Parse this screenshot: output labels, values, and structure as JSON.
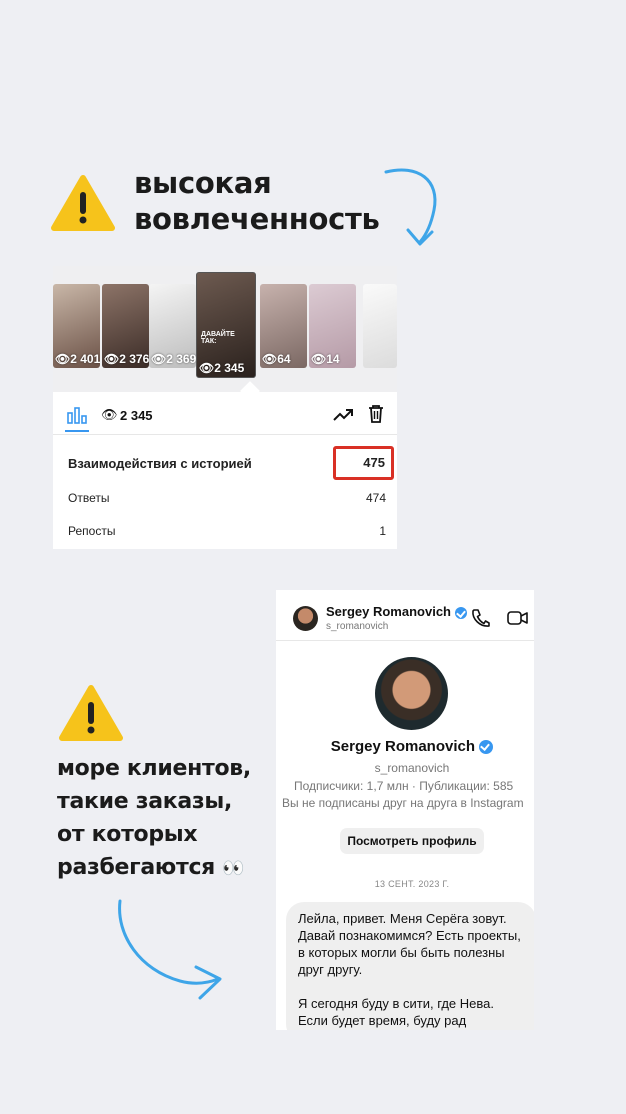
{
  "section1": {
    "warning_icon": "warning-icon",
    "headline_line1": "высокая",
    "headline_line2": "вовлеченность"
  },
  "stories": {
    "thumbnails": [
      {
        "views": "2 401"
      },
      {
        "views": "2 376"
      },
      {
        "views": "2 369"
      },
      {
        "views": "2 345"
      },
      {
        "views": "64"
      },
      {
        "views": "14"
      }
    ],
    "selected_caption": "ДАВАЙТЕ ТАК:",
    "views_total": "2 345",
    "interactions_label": "Взаимодействия с историей",
    "interactions_value": "475",
    "rows": [
      {
        "label": "Ответы",
        "value": "474"
      },
      {
        "label": "Репосты",
        "value": "1"
      }
    ]
  },
  "section2": {
    "warning_icon": "warning-icon",
    "text_lines": [
      "море клиентов,",
      "такие заказы,",
      "от которых",
      "разбегаются"
    ],
    "emoji": "👀"
  },
  "chat": {
    "header_name": "Sergey Romanovich",
    "header_username": "s_romanovich",
    "profile_name": "Sergey Romanovich",
    "profile_username": "s_romanovich",
    "stats": "Подписчики: 1,7 млн · Публикации: 585",
    "follow_note": "Вы не подписаны друг на друга в Instagram",
    "view_profile_label": "Посмотреть профиль",
    "date": "13 СЕНТ. 2023 Г.",
    "message_p1": "Лейла, привет. Меня Серёга зовут. Давай познакомимся? Есть проекты, в которых могли бы быть полезны друг другу.",
    "message_p2": "Я сегодня буду в сити, где Нева. Если будет время, буду рад познакомиться"
  },
  "colors": {
    "background": "#eeeff3",
    "arrow": "#3ea5e8",
    "highlight": "#d93025",
    "verified": "#3897f0",
    "warning": "#f6c31b"
  }
}
